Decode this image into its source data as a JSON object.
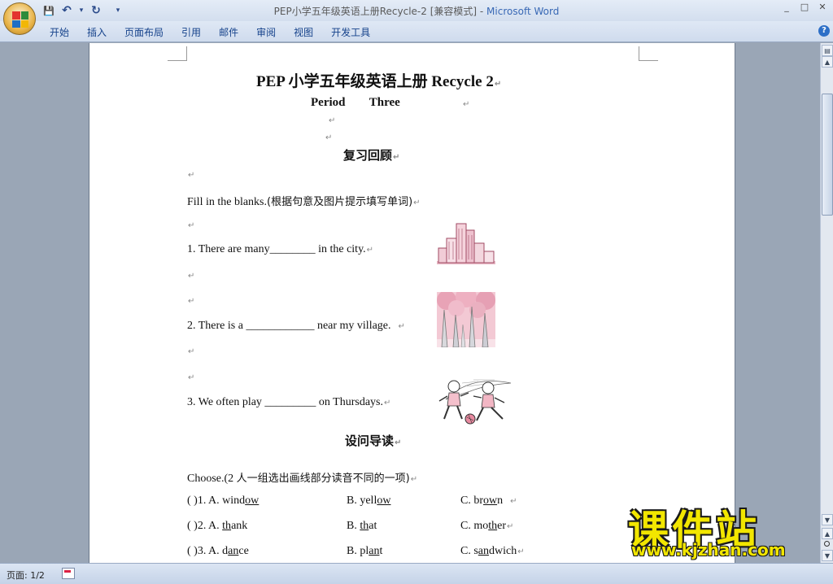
{
  "window": {
    "doc_title": "PEP小学五年级英语上册Recycle-2 [兼容模式]",
    "separator": " - ",
    "app_name": "Microsoft Word",
    "controls": [
      "_",
      "□",
      "✕"
    ]
  },
  "qat": {
    "save": "💾",
    "undo": "↶",
    "undo_dd": "▾",
    "redo": "↻",
    "customize": "▾"
  },
  "ribbon": {
    "tabs": [
      "开始",
      "插入",
      "页面布局",
      "引用",
      "邮件",
      "审阅",
      "视图",
      "开发工具"
    ],
    "help": "?"
  },
  "document": {
    "mark": "↵",
    "title": "PEP 小学五年级英语上册 Recycle 2",
    "period_label": "Period",
    "period_value": "Three",
    "section1": "复习回顾",
    "instruction1_en": "Fill in the blanks.",
    "instruction1_cn": "(根据句意及图片提示填写单词)",
    "q1": "1. There are many________ in the city.",
    "q2": "2. There is a ____________ near my village.",
    "q3": "3. We often play _________ on Thursdays.",
    "section2": "设问导读",
    "instruction2_en": "Choose.(2 ",
    "instruction2_cn": "人一组选出画线部分读音不同的一项)",
    "choices": [
      {
        "num": "(        )1. A. ",
        "a_pre": "wind",
        "a_u": "ow",
        "a_post": "",
        "b_pre": "B. yell",
        "b_u": "ow",
        "b_post": "",
        "c_pre": "C. br",
        "c_u": "ow",
        "c_post": "n"
      },
      {
        "num": "(        )2. A. ",
        "a_pre": "",
        "a_u": "th",
        "a_post": "ank",
        "b_pre": "B. ",
        "b_u": "th",
        "b_post": "at",
        "c_pre": "C. mo",
        "c_u": "th",
        "c_post": "er"
      },
      {
        "num": "(        )3. A. ",
        "a_pre": "d",
        "a_u": "an",
        "a_post": "ce",
        "b_pre": "B. pl",
        "b_u": "an",
        "b_post": "t",
        "c_pre": "C. s",
        "c_u": "an",
        "c_post": "dwich"
      }
    ]
  },
  "status": {
    "page": "页面: 1/2"
  },
  "watermark": {
    "name": "课件站",
    "url": "www.kjzhan.com"
  },
  "colors": {
    "accent": "#3868b5",
    "tab_text": "#15428b",
    "watermark": "#f2e600"
  }
}
